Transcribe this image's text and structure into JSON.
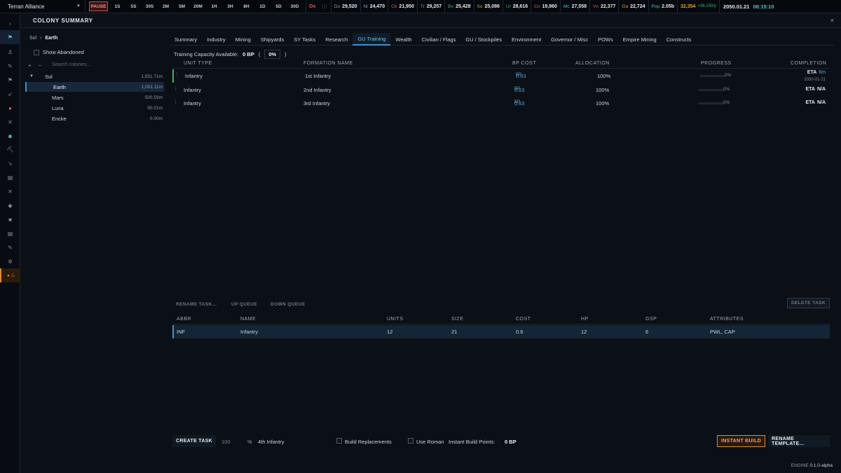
{
  "topbar": {
    "empire": "Terran Alliance",
    "pause_label": "PAUSE",
    "speeds": [
      "1S",
      "5S",
      "30S",
      "2M",
      "5M",
      "20M",
      "1H",
      "3H",
      "8H",
      "1D",
      "5D",
      "30D"
    ],
    "resources_prefix": "Ox",
    "resources": [
      {
        "abbr": "Du",
        "value": "29,520",
        "color": "#7fa7c9"
      },
      {
        "abbr": "Ni",
        "value": "24,470",
        "color": "#7fa7c9"
      },
      {
        "abbr": "Cb",
        "value": "21,950",
        "color": "#e05a5a"
      },
      {
        "abbr": "Tr",
        "value": "29,257",
        "color": "#7fa7c9"
      },
      {
        "abbr": "Bo",
        "value": "25,428",
        "color": "#3fb26a"
      },
      {
        "abbr": "So",
        "value": "25,086",
        "color": "#e0a03a"
      },
      {
        "abbr": "Ur",
        "value": "28,616",
        "color": "#3fb26a"
      },
      {
        "abbr": "Co",
        "value": "19,860",
        "color": "#e05a5a"
      },
      {
        "abbr": "Mc",
        "value": "27,558",
        "color": "#4fc3c9"
      },
      {
        "abbr": "Vn",
        "value": "22,377",
        "color": "#e05a5a"
      },
      {
        "abbr": "Ga",
        "value": "22,724",
        "color": "#e0a03a"
      }
    ],
    "pop_label": "Pop",
    "pop_value": "2.05b",
    "wealth_value": "32,354",
    "wealth_rate": "+36,150/y",
    "date": "2050.01.21",
    "clock": "08:15:10"
  },
  "header": {
    "title": "COLONY SUMMARY",
    "close": "×"
  },
  "tree": {
    "breadcrumb_root": "Sol",
    "breadcrumb_sep": "›",
    "breadcrumb_current": "Earth",
    "show_abandoned": "Show Abandoned",
    "add": "+",
    "remove": "−",
    "search_placeholder": "Search colonies...",
    "system": {
      "name": "Sol",
      "pop": "1,551.71m",
      "arrow": "▼"
    },
    "colonies": [
      {
        "name": "Earth",
        "pop": "1,001.11m"
      },
      {
        "name": "Mars",
        "pop": "500.59m"
      },
      {
        "name": "Luna",
        "pop": "50.01m"
      },
      {
        "name": "Encke",
        "pop": "0.00m"
      }
    ]
  },
  "tabs": [
    "Summary",
    "Industry",
    "Mining",
    "Shipyards",
    "SY Tasks",
    "Research",
    "GU Training",
    "Wealth",
    "Civilian / Flags",
    "GU / Stockpiles",
    "Environment",
    "Governor / Misc",
    "POWs",
    "Empire Mining",
    "Constructs"
  ],
  "capacity": {
    "label": "Training Capacity Available:",
    "bp": "0 BP",
    "open": "(",
    "pct": "0%",
    "close": ")"
  },
  "tasks": {
    "headers": {
      "unit_type": "UNIT TYPE",
      "formation": "FORMATION NAME",
      "bp_cost": "BP COST",
      "allocation": "ALLOCATION",
      "progress": "PROGRESS",
      "completion": "COMPLETION"
    },
    "rows": [
      {
        "unit": "Infantry",
        "formation": "1st Infantry",
        "bp_label": "BP",
        "bp": "0.63",
        "allocation": "100%",
        "progress": "0%",
        "progress_frac": 0,
        "eta_label": "ETA",
        "eta": "6m",
        "eta_date": "2050-01-21"
      },
      {
        "unit": "Infantry",
        "formation": "2nd Infantry",
        "bp_label": "BP",
        "bp": "0.63",
        "allocation": "100%",
        "progress": "0%",
        "progress_frac": 0,
        "eta_label": "ETA",
        "eta": "N/A",
        "eta_date": ""
      },
      {
        "unit": "Infantry",
        "formation": "3rd Infantry",
        "bp_label": "BP",
        "bp": "0.63",
        "allocation": "100%",
        "progress": "0%",
        "progress_frac": 0,
        "eta_label": "ETA",
        "eta": "N/A",
        "eta_date": ""
      }
    ]
  },
  "toolbar": {
    "rename": "RENAME TASK...",
    "up": "UP QUEUE",
    "down": "DOWN QUEUE",
    "delete": "DELETE TASK"
  },
  "templates": {
    "headers": {
      "abbr": "ABBR",
      "name": "NAME",
      "units": "UNITS",
      "size": "SIZE",
      "cost": "COST",
      "hp": "HP",
      "gsp": "GSP",
      "attributes": "ATTRIBUTES"
    },
    "row": {
      "abbr": "INF",
      "name": "Infantry",
      "units": "12",
      "size": "21",
      "cost": "0.6",
      "hp": "12",
      "gsp": "6",
      "attributes": "PWL, CAP"
    }
  },
  "footer": {
    "create_task": "CREATE TASK",
    "qty": "100",
    "pct_sign": "%",
    "formation_name": "4th Infantry",
    "build_replacements": "Build Replacements",
    "use_roman": "Use Roman",
    "instant_bp_label": "Instant Build Points:",
    "instant_bp_value": "0 BP",
    "instant_build": "INSTANT BUILD",
    "rename_template": "RENAME TEMPLATE..."
  },
  "engine": {
    "label": "ENGINE",
    "version": "0.1.0-alpha"
  },
  "rail_icons": [
    "chevron-right-icon",
    "flag-icon",
    "anchor-icon",
    "wrench-icon",
    "flag-small-icon",
    "rocket-icon",
    "target-icon",
    "swords-icon",
    "person-icon",
    "pickaxe-icon",
    "telescope-icon",
    "clipboard-icon",
    "cross-icon",
    "tag-icon",
    "box-icon",
    "list-icon",
    "tool-icon",
    "gear-icon",
    "alert-icon"
  ]
}
